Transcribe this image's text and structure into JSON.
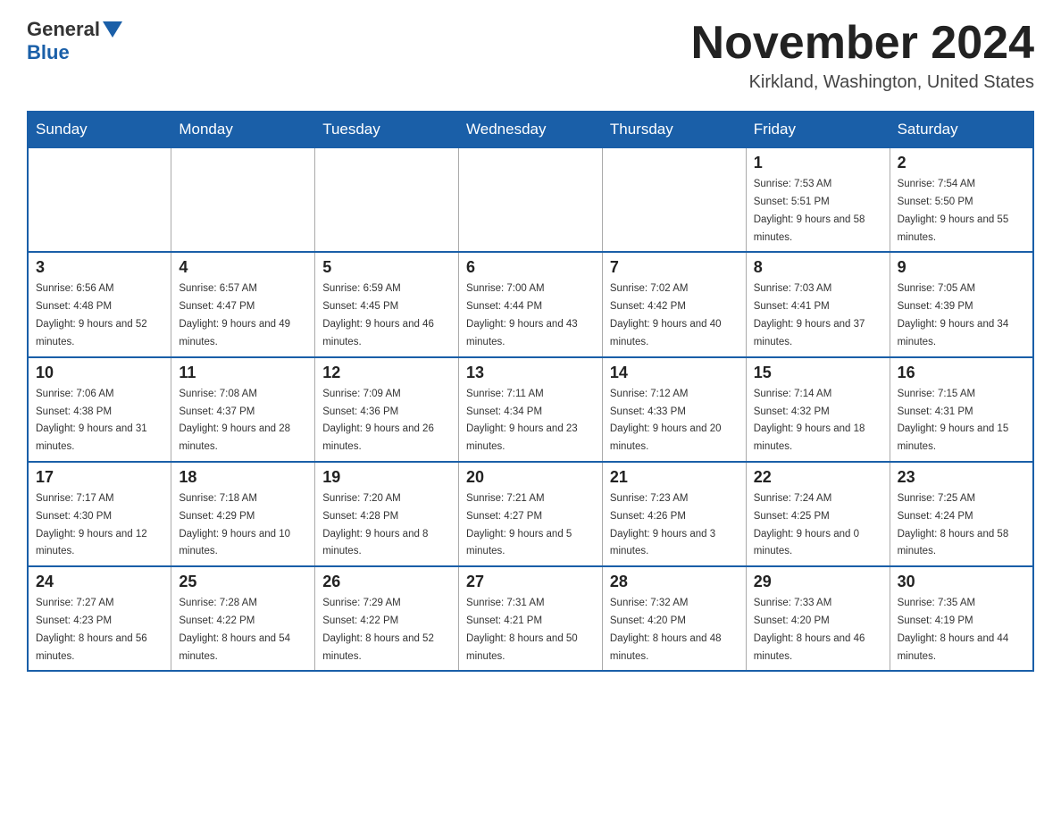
{
  "header": {
    "logo_general": "General",
    "logo_blue": "Blue",
    "title": "November 2024",
    "subtitle": "Kirkland, Washington, United States"
  },
  "days_of_week": [
    "Sunday",
    "Monday",
    "Tuesday",
    "Wednesday",
    "Thursday",
    "Friday",
    "Saturday"
  ],
  "weeks": [
    [
      {
        "day": "",
        "empty": true
      },
      {
        "day": "",
        "empty": true
      },
      {
        "day": "",
        "empty": true
      },
      {
        "day": "",
        "empty": true
      },
      {
        "day": "",
        "empty": true
      },
      {
        "day": "1",
        "sunrise": "7:53 AM",
        "sunset": "5:51 PM",
        "daylight": "9 hours and 58 minutes."
      },
      {
        "day": "2",
        "sunrise": "7:54 AM",
        "sunset": "5:50 PM",
        "daylight": "9 hours and 55 minutes."
      }
    ],
    [
      {
        "day": "3",
        "sunrise": "6:56 AM",
        "sunset": "4:48 PM",
        "daylight": "9 hours and 52 minutes."
      },
      {
        "day": "4",
        "sunrise": "6:57 AM",
        "sunset": "4:47 PM",
        "daylight": "9 hours and 49 minutes."
      },
      {
        "day": "5",
        "sunrise": "6:59 AM",
        "sunset": "4:45 PM",
        "daylight": "9 hours and 46 minutes."
      },
      {
        "day": "6",
        "sunrise": "7:00 AM",
        "sunset": "4:44 PM",
        "daylight": "9 hours and 43 minutes."
      },
      {
        "day": "7",
        "sunrise": "7:02 AM",
        "sunset": "4:42 PM",
        "daylight": "9 hours and 40 minutes."
      },
      {
        "day": "8",
        "sunrise": "7:03 AM",
        "sunset": "4:41 PM",
        "daylight": "9 hours and 37 minutes."
      },
      {
        "day": "9",
        "sunrise": "7:05 AM",
        "sunset": "4:39 PM",
        "daylight": "9 hours and 34 minutes."
      }
    ],
    [
      {
        "day": "10",
        "sunrise": "7:06 AM",
        "sunset": "4:38 PM",
        "daylight": "9 hours and 31 minutes."
      },
      {
        "day": "11",
        "sunrise": "7:08 AM",
        "sunset": "4:37 PM",
        "daylight": "9 hours and 28 minutes."
      },
      {
        "day": "12",
        "sunrise": "7:09 AM",
        "sunset": "4:36 PM",
        "daylight": "9 hours and 26 minutes."
      },
      {
        "day": "13",
        "sunrise": "7:11 AM",
        "sunset": "4:34 PM",
        "daylight": "9 hours and 23 minutes."
      },
      {
        "day": "14",
        "sunrise": "7:12 AM",
        "sunset": "4:33 PM",
        "daylight": "9 hours and 20 minutes."
      },
      {
        "day": "15",
        "sunrise": "7:14 AM",
        "sunset": "4:32 PM",
        "daylight": "9 hours and 18 minutes."
      },
      {
        "day": "16",
        "sunrise": "7:15 AM",
        "sunset": "4:31 PM",
        "daylight": "9 hours and 15 minutes."
      }
    ],
    [
      {
        "day": "17",
        "sunrise": "7:17 AM",
        "sunset": "4:30 PM",
        "daylight": "9 hours and 12 minutes."
      },
      {
        "day": "18",
        "sunrise": "7:18 AM",
        "sunset": "4:29 PM",
        "daylight": "9 hours and 10 minutes."
      },
      {
        "day": "19",
        "sunrise": "7:20 AM",
        "sunset": "4:28 PM",
        "daylight": "9 hours and 8 minutes."
      },
      {
        "day": "20",
        "sunrise": "7:21 AM",
        "sunset": "4:27 PM",
        "daylight": "9 hours and 5 minutes."
      },
      {
        "day": "21",
        "sunrise": "7:23 AM",
        "sunset": "4:26 PM",
        "daylight": "9 hours and 3 minutes."
      },
      {
        "day": "22",
        "sunrise": "7:24 AM",
        "sunset": "4:25 PM",
        "daylight": "9 hours and 0 minutes."
      },
      {
        "day": "23",
        "sunrise": "7:25 AM",
        "sunset": "4:24 PM",
        "daylight": "8 hours and 58 minutes."
      }
    ],
    [
      {
        "day": "24",
        "sunrise": "7:27 AM",
        "sunset": "4:23 PM",
        "daylight": "8 hours and 56 minutes."
      },
      {
        "day": "25",
        "sunrise": "7:28 AM",
        "sunset": "4:22 PM",
        "daylight": "8 hours and 54 minutes."
      },
      {
        "day": "26",
        "sunrise": "7:29 AM",
        "sunset": "4:22 PM",
        "daylight": "8 hours and 52 minutes."
      },
      {
        "day": "27",
        "sunrise": "7:31 AM",
        "sunset": "4:21 PM",
        "daylight": "8 hours and 50 minutes."
      },
      {
        "day": "28",
        "sunrise": "7:32 AM",
        "sunset": "4:20 PM",
        "daylight": "8 hours and 48 minutes."
      },
      {
        "day": "29",
        "sunrise": "7:33 AM",
        "sunset": "4:20 PM",
        "daylight": "8 hours and 46 minutes."
      },
      {
        "day": "30",
        "sunrise": "7:35 AM",
        "sunset": "4:19 PM",
        "daylight": "8 hours and 44 minutes."
      }
    ]
  ]
}
